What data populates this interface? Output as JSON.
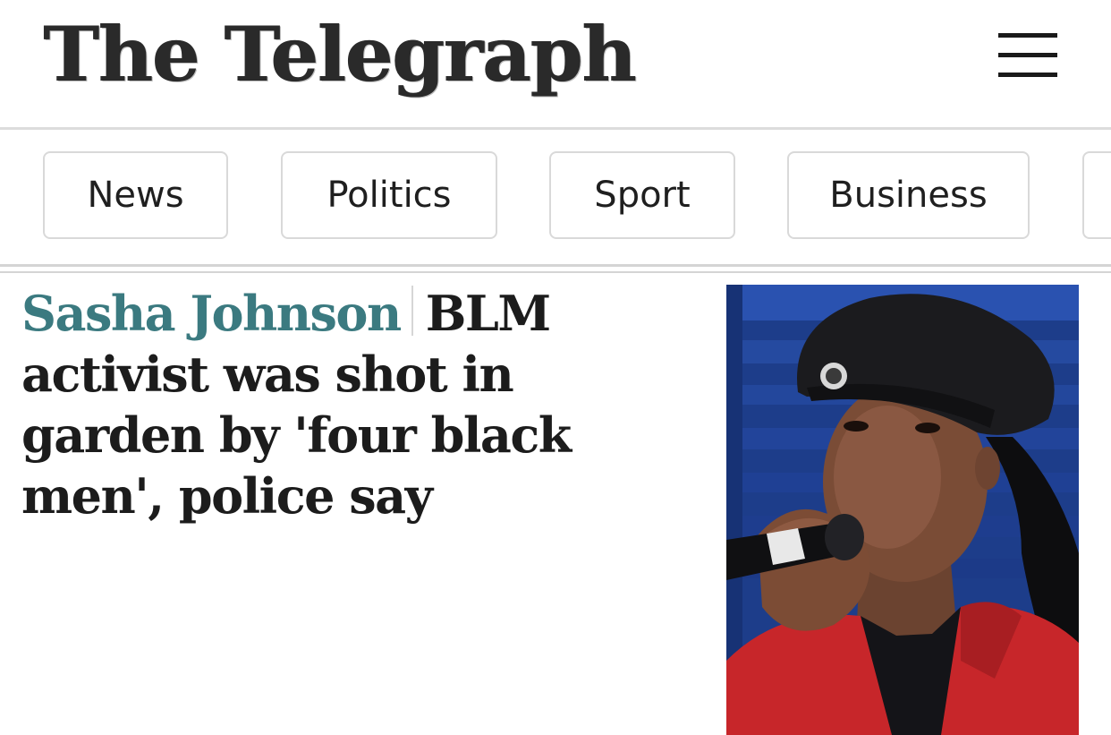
{
  "masthead": {
    "logo_text": "The Telegraph",
    "menu_icon": "hamburger-menu-icon"
  },
  "nav": {
    "tabs": [
      {
        "label": "News"
      },
      {
        "label": "Politics"
      },
      {
        "label": "Sport"
      },
      {
        "label": "Business"
      }
    ]
  },
  "article": {
    "kicker": "Sasha Johnson",
    "headline": "BLM activist was shot in garden by 'four black men', police say",
    "image_alt": "Woman in a black beret and red jacket speaking into a microphone"
  },
  "colors": {
    "kicker": "#3b7a80",
    "text": "#1c1c1c",
    "rule": "#d4d4d4"
  }
}
